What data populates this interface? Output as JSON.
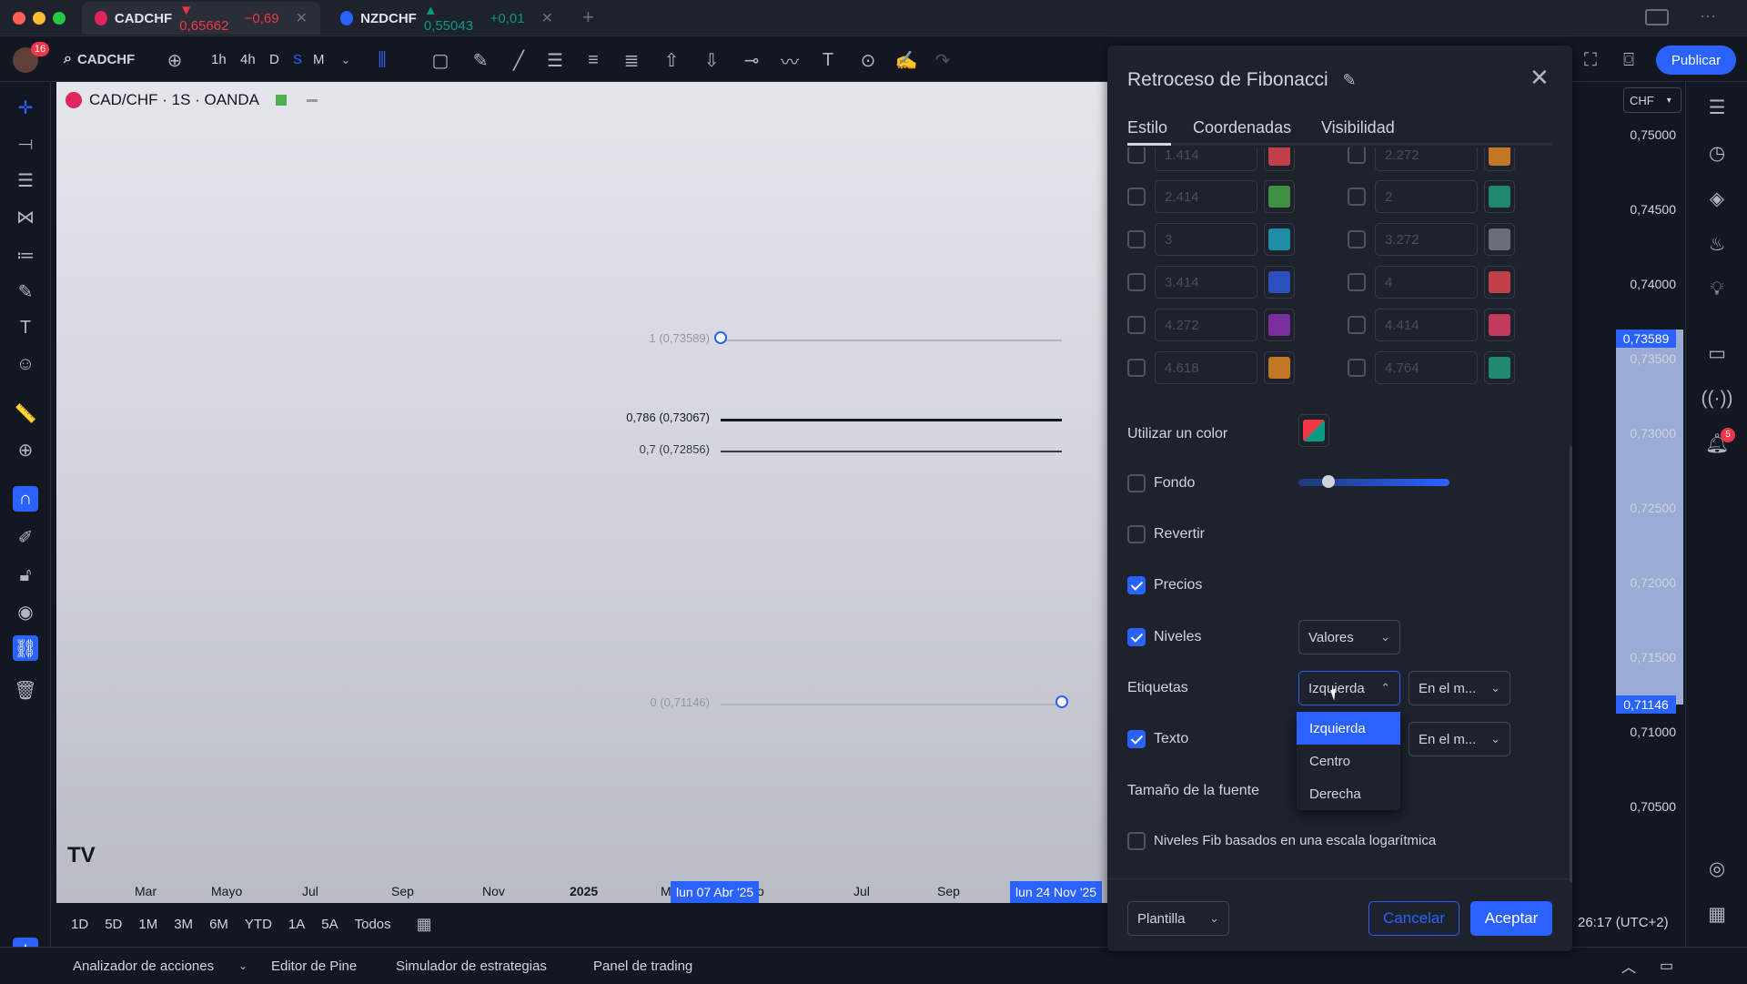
{
  "browser_tabs": [
    {
      "symbol": "CADCHF",
      "price": "▼ 0,65662",
      "change": "−0,69",
      "close": "✕"
    },
    {
      "symbol": "NZDCHF",
      "price": "▲ 0,55043",
      "change": "+0,01",
      "close": "✕"
    }
  ],
  "new_tab": "+",
  "toolbar": {
    "avatar_badge": "16",
    "symbol": "CADCHF",
    "intervals": [
      "1h",
      "4h",
      "D",
      "S",
      "M"
    ],
    "publish": "Publicar"
  },
  "chart": {
    "title": "CAD/CHF · 1S · OANDA",
    "fib_levels": [
      {
        "label": "1 (0,73589)",
        "level": 1
      },
      {
        "label": "0,786 (0,73067)",
        "level": 0.786
      },
      {
        "label": "0,7 (0,72856)",
        "level": 0.7
      },
      {
        "label": "0 (0,71146)",
        "level": 0
      }
    ],
    "time_axis": [
      "Mar",
      "Mayo",
      "Jul",
      "Sep",
      "Nov",
      "2025",
      "M",
      "o",
      "Jul",
      "Sep"
    ],
    "time_markers": [
      "lun 07 Abr '25",
      "lun 24 Nov '25"
    ],
    "watermark": "TV"
  },
  "price_scale": {
    "currency": "CHF",
    "labels": [
      "0,75000",
      "0,74500",
      "0,74000",
      "0,73500",
      "0,73000",
      "0,72500",
      "0,72000",
      "0,71500",
      "0,71000",
      "0,70500"
    ],
    "highlight_top": "0,73589",
    "highlight_bottom": "0,71146"
  },
  "range_bar": [
    "1D",
    "5D",
    "1M",
    "3M",
    "6M",
    "YTD",
    "1A",
    "5A",
    "Todos"
  ],
  "clock": "26:17 (UTC+2)",
  "bottom_panel": [
    "Analizador de acciones",
    "Editor de Pine",
    "Simulador de estrategias",
    "Panel de trading"
  ],
  "dialog": {
    "title": "Retroceso de Fibonacci",
    "tabs": [
      "Estilo",
      "Coordenadas",
      "Visibilidad"
    ],
    "levels_left": [
      {
        "value": "1.414",
        "color": "#c2404a"
      },
      {
        "value": "2.414",
        "color": "#3f9142"
      },
      {
        "value": "3",
        "color": "#1e8ea8"
      },
      {
        "value": "3.414",
        "color": "#2b4fbf"
      },
      {
        "value": "4.272",
        "color": "#7a2e9e"
      },
      {
        "value": "4.618",
        "color": "#c27724"
      }
    ],
    "levels_right": [
      {
        "value": "2.272",
        "color": "#c27724"
      },
      {
        "value": "2",
        "color": "#1f8a6e"
      },
      {
        "value": "3.272",
        "color": "#6a6d78"
      },
      {
        "value": "4",
        "color": "#c2404a"
      },
      {
        "value": "4.414",
        "color": "#c23a5c"
      },
      {
        "value": "4.764",
        "color": "#1f8a6e"
      }
    ],
    "use_one_color": "Utilizar un color",
    "background": "Fondo",
    "background_opacity": 0.2,
    "reverse": "Revertir",
    "prices": "Precios",
    "levels": "Niveles",
    "levels_select": "Valores",
    "labels": "Etiquetas",
    "labels_h_select": "Izquierda",
    "labels_v_select": "En el m...",
    "text": "Texto",
    "text_v_select": "En el m...",
    "font_size": "Tamaño de la fuente",
    "log_scale": "Niveles Fib basados en una escala logarítmica",
    "dropdown_options": [
      "Izquierda",
      "Centro",
      "Derecha"
    ],
    "template": "Plantilla",
    "cancel": "Cancelar",
    "accept": "Aceptar",
    "colors": {
      "accent": "#2962ff"
    }
  }
}
